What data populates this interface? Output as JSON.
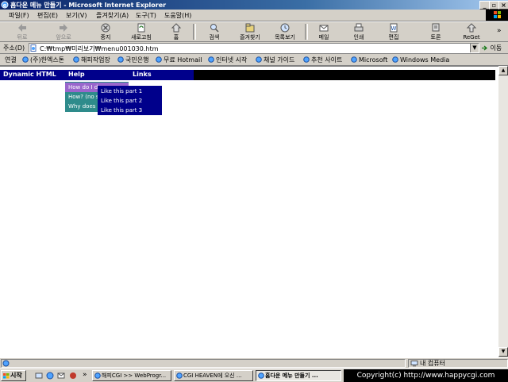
{
  "window": {
    "title": "홈다운 메뉴 만들기 - Microsoft Internet Explorer",
    "controls": [
      "_",
      "▫",
      "×"
    ]
  },
  "menubar": {
    "items": [
      "파일(F)",
      "편집(E)",
      "보기(V)",
      "즐겨찾기(A)",
      "도구(T)",
      "도움말(H)"
    ]
  },
  "toolbar": {
    "buttons": [
      {
        "label": "뒤로",
        "icon": "back-arrow-icon"
      },
      {
        "label": "앞으로",
        "icon": "forward-arrow-icon"
      },
      {
        "label": "중지",
        "icon": "stop-icon"
      },
      {
        "label": "새로고침",
        "icon": "refresh-icon"
      },
      {
        "label": "홈",
        "icon": "home-icon"
      },
      {
        "label": "검색",
        "icon": "search-icon"
      },
      {
        "label": "즐겨찾기",
        "icon": "favorites-icon"
      },
      {
        "label": "목록보기",
        "icon": "history-icon"
      },
      {
        "label": "메일",
        "icon": "mail-icon"
      },
      {
        "label": "인쇄",
        "icon": "print-icon"
      },
      {
        "label": "편집",
        "icon": "edit-icon"
      },
      {
        "label": "토론",
        "icon": "discuss-icon"
      },
      {
        "label": "ReGet",
        "icon": "reget-icon"
      }
    ],
    "more": "»"
  },
  "addressbar": {
    "label": "주소(D)",
    "url": "C:₩tmp₩미리보기₩menu001030.htm",
    "go_label": "이동"
  },
  "linksbar": {
    "label": "연결",
    "items": [
      "(주)한엑스톤",
      "해피작업장",
      "국민은행",
      "무료 Hotmail",
      "인터넷 시작",
      "채널 가이드",
      "추천 사이트",
      "Microsoft",
      "Windows Media"
    ]
  },
  "page": {
    "nav": {
      "items": [
        "Dynamic HTML",
        "Help",
        "Links"
      ]
    },
    "dropdown": {
      "items": [
        "How do I d",
        "How? (no s",
        "Why does"
      ],
      "selected_index": 0
    },
    "submenu": {
      "items": [
        "Like this part 1",
        "Like this part 2",
        "Like this part 3"
      ]
    }
  },
  "statusbar": {
    "text": "",
    "zone": "내 컴퓨터"
  },
  "taskbar": {
    "start": "시작",
    "tasks": [
      {
        "label": "해피CGI >> WebProgr...",
        "active": false
      },
      {
        "label": "CGI HEAVEN에 오신 ...",
        "active": false
      },
      {
        "label": "홈다운 메뉴 만들기 ...",
        "active": true
      }
    ],
    "tray_text": "Copyright(c) http://www.happycgi.com"
  },
  "colors": {
    "titlebar": "#0a246a",
    "nav_blue": "#00008b",
    "nav_black": "#000000",
    "dropdown_teal": "#2e8b8b",
    "dropdown_selected": "#9966cc",
    "submenu_blue": "#00008b"
  }
}
